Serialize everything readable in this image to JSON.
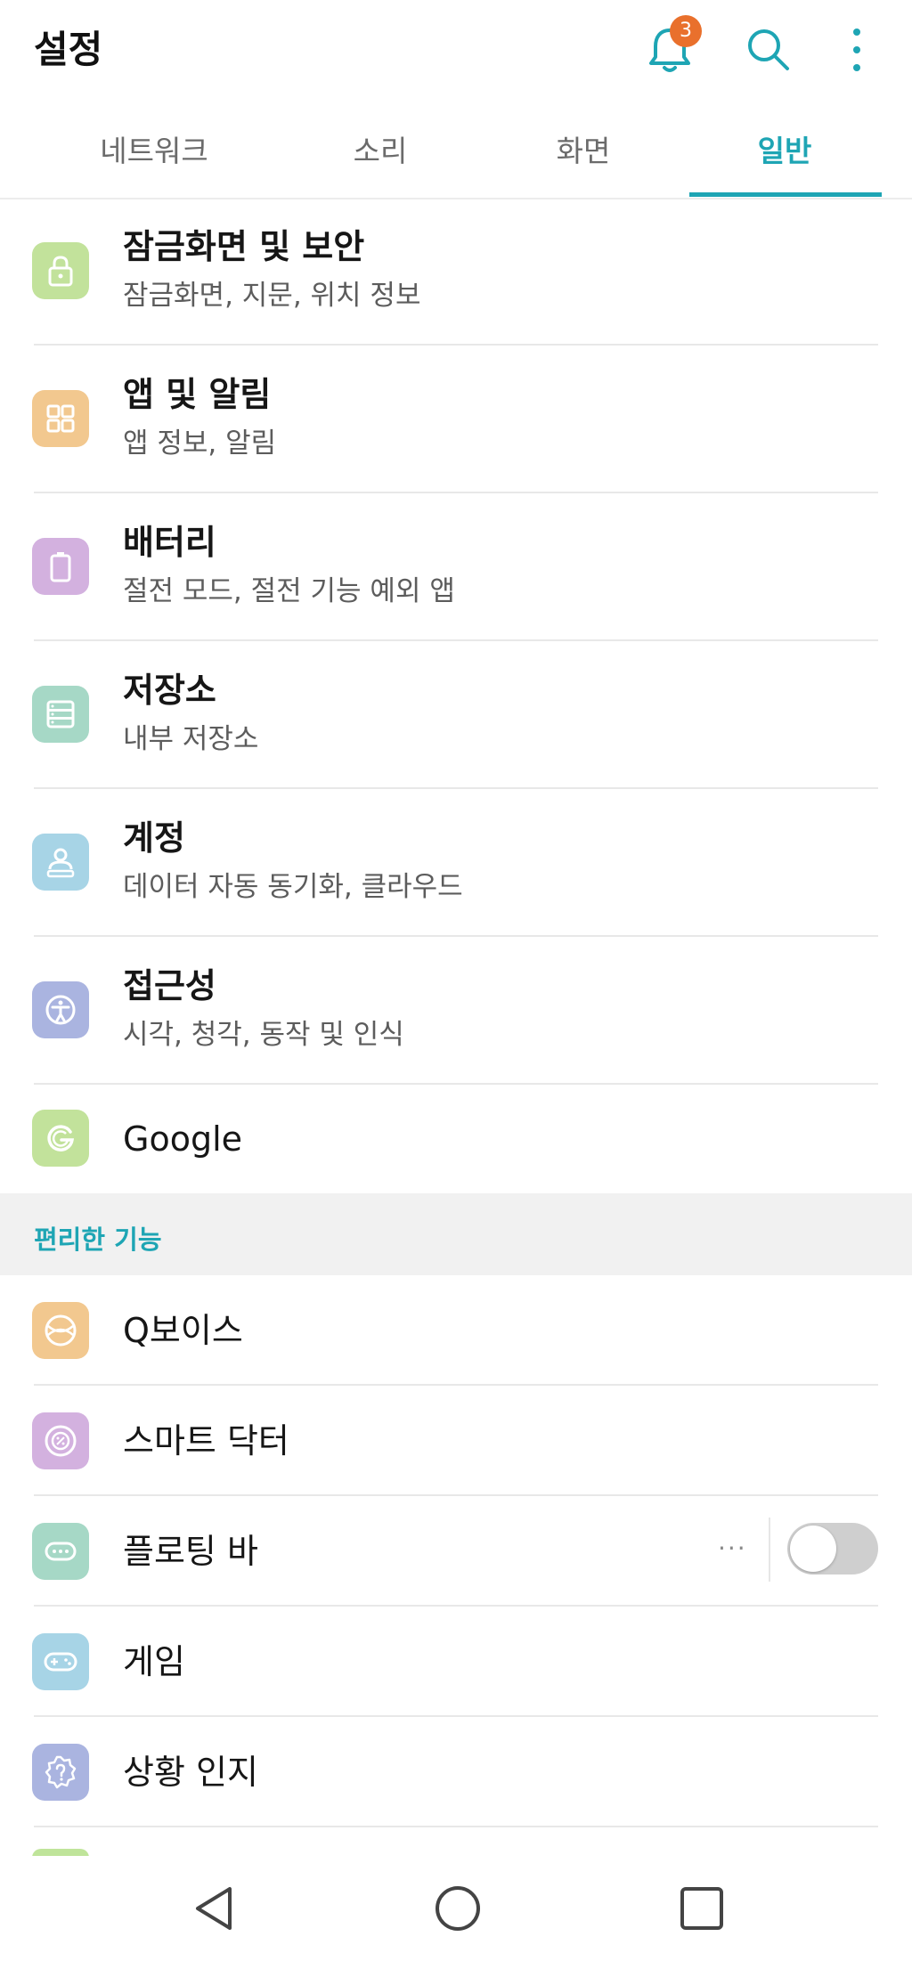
{
  "header": {
    "title": "설정",
    "notification_count": "3"
  },
  "tabs": [
    {
      "label": "네트워크",
      "active": false
    },
    {
      "label": "소리",
      "active": false
    },
    {
      "label": "화면",
      "active": false
    },
    {
      "label": "일반",
      "active": true
    }
  ],
  "items": [
    {
      "title": "잠금화면 및 보안",
      "subtitle": "잠금화면, 지문, 위치 정보",
      "icon": "lock-icon",
      "color": "#c2e29b"
    },
    {
      "title": "앱 및 알림",
      "subtitle": "앱 정보, 알림",
      "icon": "apps-grid-icon",
      "color": "#f2c88f"
    },
    {
      "title": "배터리",
      "subtitle": "절전 모드, 절전 기능 예외 앱",
      "icon": "battery-icon",
      "color": "#d3b1df"
    },
    {
      "title": "저장소",
      "subtitle": "내부 저장소",
      "icon": "storage-icon",
      "color": "#a6d8c6"
    },
    {
      "title": "계정",
      "subtitle": "데이터 자동 동기화, 클라우드",
      "icon": "account-icon",
      "color": "#a7d4e6"
    },
    {
      "title": "접근성",
      "subtitle": "시각, 청각, 동작 및 인식",
      "icon": "accessibility-icon",
      "color": "#aab4e0"
    },
    {
      "title": "Google",
      "icon": "google-icon",
      "color": "#c2e29b"
    }
  ],
  "section": {
    "label": "편리한 기능"
  },
  "feature_items": [
    {
      "title": "Q보이스",
      "icon": "qvoice-icon",
      "color": "#f2c88f"
    },
    {
      "title": "스마트 닥터",
      "icon": "smart-doctor-icon",
      "color": "#d3b1df"
    },
    {
      "title": "플로팅 바",
      "icon": "floating-bar-icon",
      "color": "#a6d8c6",
      "more_label": "···",
      "toggle_on": false
    },
    {
      "title": "게임",
      "icon": "gamepad-icon",
      "color": "#a7d4e6"
    },
    {
      "title": "상황 인지",
      "icon": "context-aware-icon",
      "color": "#aab4e0"
    }
  ],
  "colors": {
    "accent": "#1ea5b4",
    "badge": "#e9702c"
  }
}
